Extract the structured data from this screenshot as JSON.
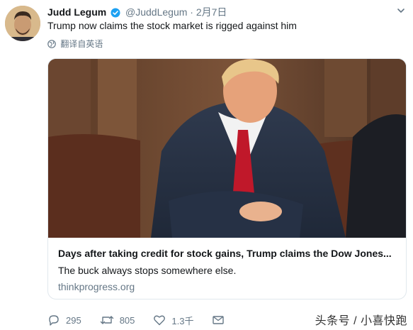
{
  "tweet": {
    "author_name": "Judd Legum",
    "handle": "@JuddLegum",
    "separator": "·",
    "date": "2月7日",
    "text": "Trump now claims the stock market is rigged against him",
    "translate_label": "翻译自英语"
  },
  "card": {
    "title": "Days after taking credit for stock gains, Trump claims the Dow Jones...",
    "description": "The buck always stops somewhere else.",
    "domain": "thinkprogress.org"
  },
  "actions": {
    "reply_count": "295",
    "retweet_count": "805",
    "like_count": "1.3千"
  },
  "watermark": "头条号 / 小喜快跑",
  "colors": {
    "verified": "#1da1f2",
    "secondary_text": "#657786",
    "card_border": "#e1e8ed"
  }
}
